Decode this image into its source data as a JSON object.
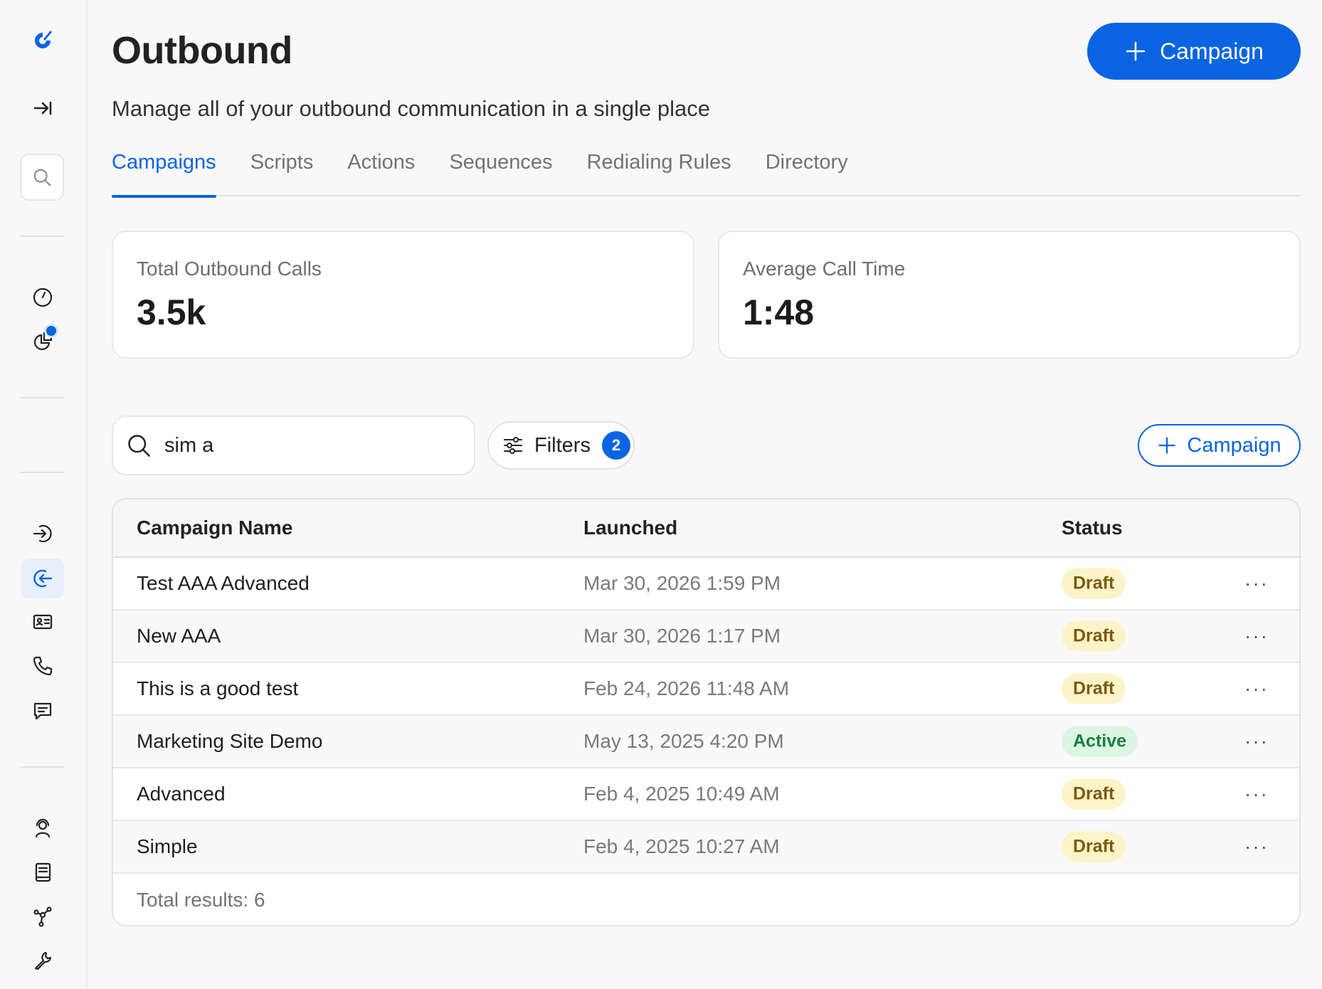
{
  "header": {
    "title": "Outbound",
    "subtitle": "Manage all of your outbound communication in a single place",
    "primary_action_label": "Campaign"
  },
  "tabs": [
    {
      "label": "Campaigns",
      "active": true
    },
    {
      "label": "Scripts",
      "active": false
    },
    {
      "label": "Actions",
      "active": false
    },
    {
      "label": "Sequences",
      "active": false
    },
    {
      "label": "Redialing Rules",
      "active": false
    },
    {
      "label": "Directory",
      "active": false
    }
  ],
  "stats": [
    {
      "label": "Total Outbound Calls",
      "value": "3.5k"
    },
    {
      "label": "Average Call Time",
      "value": "1:48"
    }
  ],
  "toolbar": {
    "search_value": "sim a",
    "filters_label": "Filters",
    "filters_count": "2",
    "add_label": "Campaign"
  },
  "table": {
    "columns": [
      "Campaign Name",
      "Launched",
      "Status"
    ],
    "rows": [
      {
        "name": "Test AAA Advanced",
        "launched": "Mar 30, 2026 1:59 PM",
        "status": "Draft"
      },
      {
        "name": "New AAA",
        "launched": "Mar 30, 2026 1:17 PM",
        "status": "Draft"
      },
      {
        "name": "This is a good test",
        "launched": "Feb 24, 2026 11:48 AM",
        "status": "Draft"
      },
      {
        "name": "Marketing Site Demo",
        "launched": "May 13, 2025 4:20 PM",
        "status": "Active"
      },
      {
        "name": "Advanced",
        "launched": "Feb 4, 2025 10:49 AM",
        "status": "Draft"
      },
      {
        "name": "Simple",
        "launched": "Feb 4, 2025 10:27 AM",
        "status": "Draft"
      }
    ],
    "row_menu_glyph": "···",
    "footer": "Total results: 6"
  },
  "sidebar": {
    "icons": [
      "logo-icon",
      "expand-sidebar-icon",
      "search-icon",
      "dashboard-gauge-icon",
      "analytics-pie-icon",
      "inbound-icon",
      "outbound-icon",
      "contact-card-icon",
      "phone-icon",
      "chat-icon",
      "agent-icon",
      "knowledge-book-icon",
      "integrations-icon",
      "settings-wrench-icon"
    ],
    "active": "outbound-icon"
  },
  "colors": {
    "accent": "#0a64e1",
    "draft_bg": "#fdf3c8",
    "draft_text": "#7a5b10",
    "active_bg": "#dcf6e4",
    "active_text": "#15803d"
  }
}
